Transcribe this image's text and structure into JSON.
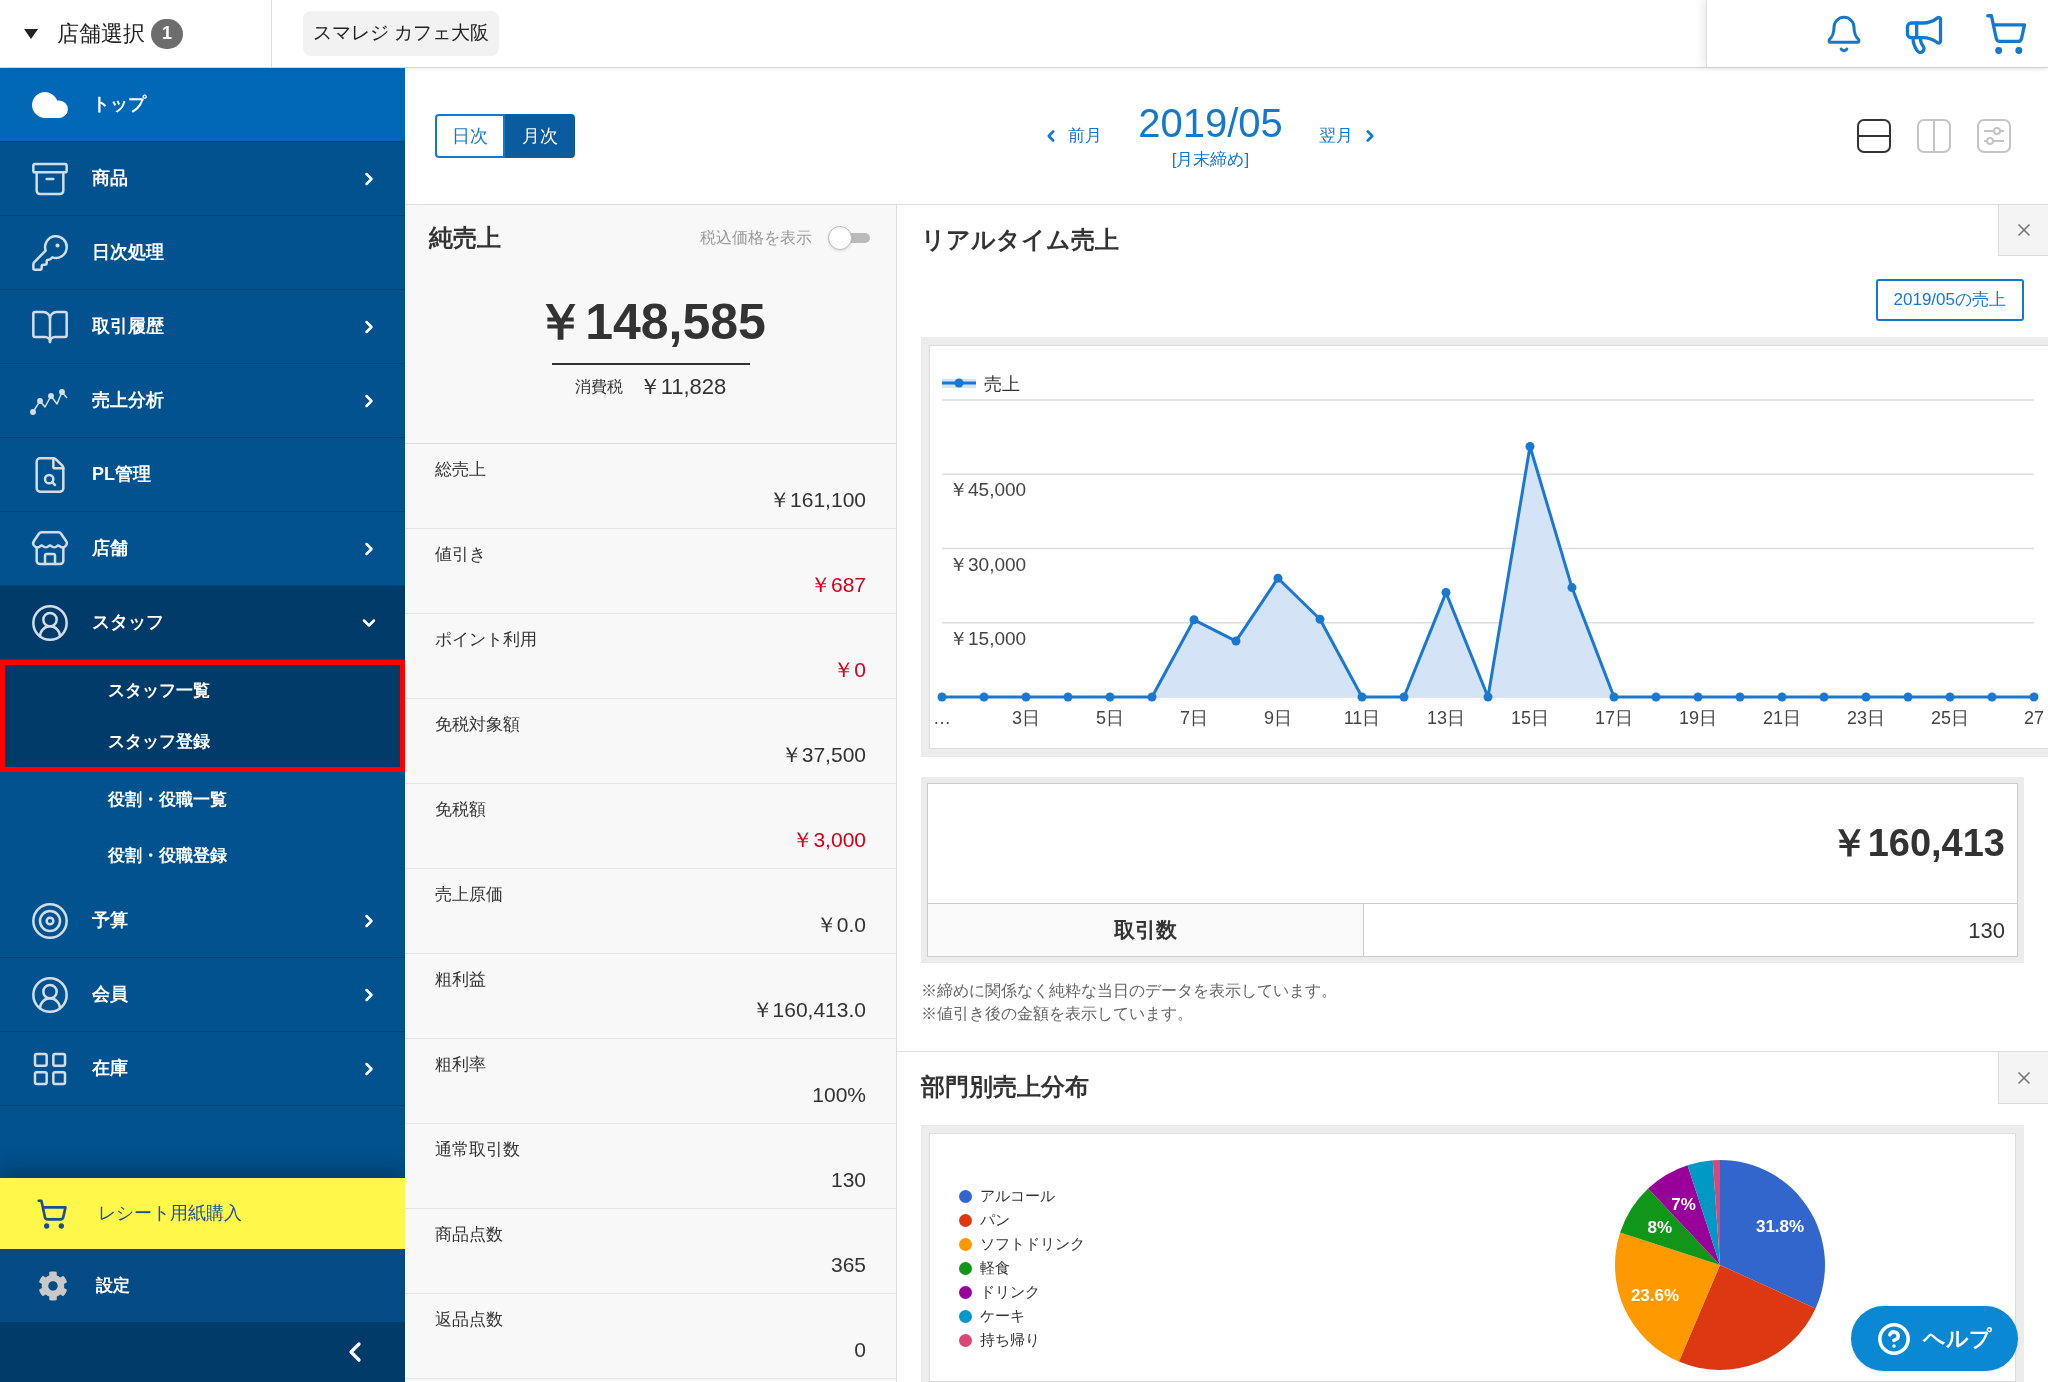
{
  "store_bar": {
    "label": "店舗選択",
    "badge": "1",
    "store": "スマレジ カフェ大阪"
  },
  "sidebar": {
    "items": [
      {
        "label": "トップ",
        "kind": "link",
        "selected": true
      },
      {
        "label": "商品",
        "kind": "menu",
        "selected": false,
        "expanded": false
      },
      {
        "label": "日次処理",
        "kind": "link",
        "selected": false
      },
      {
        "label": "取引履歴",
        "kind": "menu",
        "selected": false,
        "expanded": false
      },
      {
        "label": "売上分析",
        "kind": "menu",
        "selected": false,
        "expanded": false
      },
      {
        "label": "PL管理",
        "kind": "link",
        "selected": false
      },
      {
        "label": "店舗",
        "kind": "menu",
        "selected": false,
        "expanded": false
      },
      {
        "label": "スタッフ",
        "kind": "menu",
        "selected": false,
        "expanded": true,
        "children": [
          {
            "label": "スタッフ一覧",
            "highlighted": true
          },
          {
            "label": "スタッフ登録",
            "highlighted": true
          },
          {
            "label": "役割・役職一覧",
            "highlighted": false
          },
          {
            "label": "役割・役職登録",
            "highlighted": false
          }
        ]
      },
      {
        "label": "予算",
        "kind": "menu",
        "selected": false,
        "expanded": false
      },
      {
        "label": "会員",
        "kind": "menu",
        "selected": false,
        "expanded": false
      },
      {
        "label": "在庫",
        "kind": "menu",
        "selected": false,
        "expanded": false
      }
    ],
    "purchase_link": "レシート用紙購入",
    "settings": "設定"
  },
  "period_tabs": [
    {
      "label": "日次",
      "selected": false
    },
    {
      "label": "月次",
      "selected": true
    }
  ],
  "period_nav": {
    "previous": "前月",
    "current": "2019/05",
    "closing": "[月末締め]",
    "next": "翌月"
  },
  "view_buttons": [
    {
      "kind": "rows",
      "selected": true
    },
    {
      "kind": "columns",
      "selected": false
    },
    {
      "kind": "settings",
      "selected": false
    }
  ],
  "net_sales": {
    "title": "純売上",
    "tax_toggle": {
      "label": "税込価格を表示",
      "on": false
    },
    "amount": "￥148,585",
    "tax_label": "消費税",
    "tax_amount": "￥11,828",
    "rows": [
      {
        "label": "総売上",
        "value": "￥161,100",
        "negative": false
      },
      {
        "label": "値引き",
        "value": "￥687",
        "negative": true
      },
      {
        "label": "ポイント利用",
        "value": "￥0",
        "negative": true
      },
      {
        "label": "免税対象額",
        "value": "￥37,500",
        "negative": false
      },
      {
        "label": "免税額",
        "value": "￥3,000",
        "negative": true
      },
      {
        "label": "売上原価",
        "value": "￥0.0",
        "negative": false
      },
      {
        "label": "粗利益",
        "value": "￥160,413.0",
        "negative": false
      },
      {
        "label": "粗利率",
        "value": "100%",
        "negative": false
      },
      {
        "label": "通常取引数",
        "value": "130",
        "negative": false
      },
      {
        "label": "商品点数",
        "value": "365",
        "negative": false
      },
      {
        "label": "返品点数",
        "value": "0",
        "negative": false
      }
    ]
  },
  "realtime_sales": {
    "title": "リアルタイム売上",
    "period_button": "2019/05の売上",
    "chart_data": {
      "type": "area",
      "grid": true,
      "x": [
        1,
        2,
        3,
        4,
        5,
        6,
        7,
        8,
        9,
        10,
        11,
        12,
        13,
        14,
        15,
        16,
        17,
        18,
        19,
        20,
        21,
        22,
        23,
        24,
        25,
        26,
        27
      ],
      "series": [
        {
          "name": "売上",
          "color": "#1a78d1",
          "values": [
            0,
            0,
            0,
            0,
            0,
            0,
            15600,
            11300,
            24000,
            15700,
            0,
            0,
            21100,
            0,
            50600,
            22100,
            0,
            0,
            0,
            0,
            0,
            0,
            0,
            0,
            0,
            0,
            0
          ]
        }
      ],
      "xlim": [
        1,
        27
      ],
      "xticks": [
        {
          "value": 1,
          "label": "…"
        },
        {
          "value": 3,
          "label": "3日"
        },
        {
          "value": 5,
          "label": "5日"
        },
        {
          "value": 7,
          "label": "7日"
        },
        {
          "value": 9,
          "label": "9日"
        },
        {
          "value": 11,
          "label": "11日"
        },
        {
          "value": 13,
          "label": "13日"
        },
        {
          "value": 15,
          "label": "15日"
        },
        {
          "value": 17,
          "label": "17日"
        },
        {
          "value": 19,
          "label": "19日"
        },
        {
          "value": 21,
          "label": "21日"
        },
        {
          "value": 23,
          "label": "23日"
        },
        {
          "value": 25,
          "label": "25日"
        },
        {
          "value": 27,
          "label": "27"
        }
      ],
      "ylim": [
        0,
        60000
      ],
      "yticks": [
        {
          "value": 15000,
          "label": "￥15,000"
        },
        {
          "value": 30000,
          "label": "￥30,000"
        },
        {
          "value": 45000,
          "label": "￥45,000"
        }
      ]
    },
    "total": "￥160,413",
    "count_label": "取引数",
    "count": "130",
    "notes": [
      "※締めに関係なく純粋な当日のデータを表示しています。",
      "※値引き後の金額を表示しています。"
    ]
  },
  "department_sales": {
    "title": "部門別売上分布",
    "chart_data": {
      "type": "pie",
      "categories": [
        "アルコール",
        "パン",
        "ソフトドリンク",
        "軽食",
        "ドリンク",
        "ケーキ",
        "持ち帰り"
      ],
      "values": [
        31.8,
        24.6,
        23.6,
        8,
        7,
        3.9,
        1.1
      ],
      "value_labels": [
        "31.8%",
        null,
        "23.6%",
        "8%",
        "7%",
        null,
        null
      ],
      "colors": [
        "#3366cc",
        "#dc3912",
        "#ff9900",
        "#109618",
        "#990099",
        "#0099c6",
        "#dd4477"
      ]
    }
  },
  "help_button": "ヘルプ"
}
